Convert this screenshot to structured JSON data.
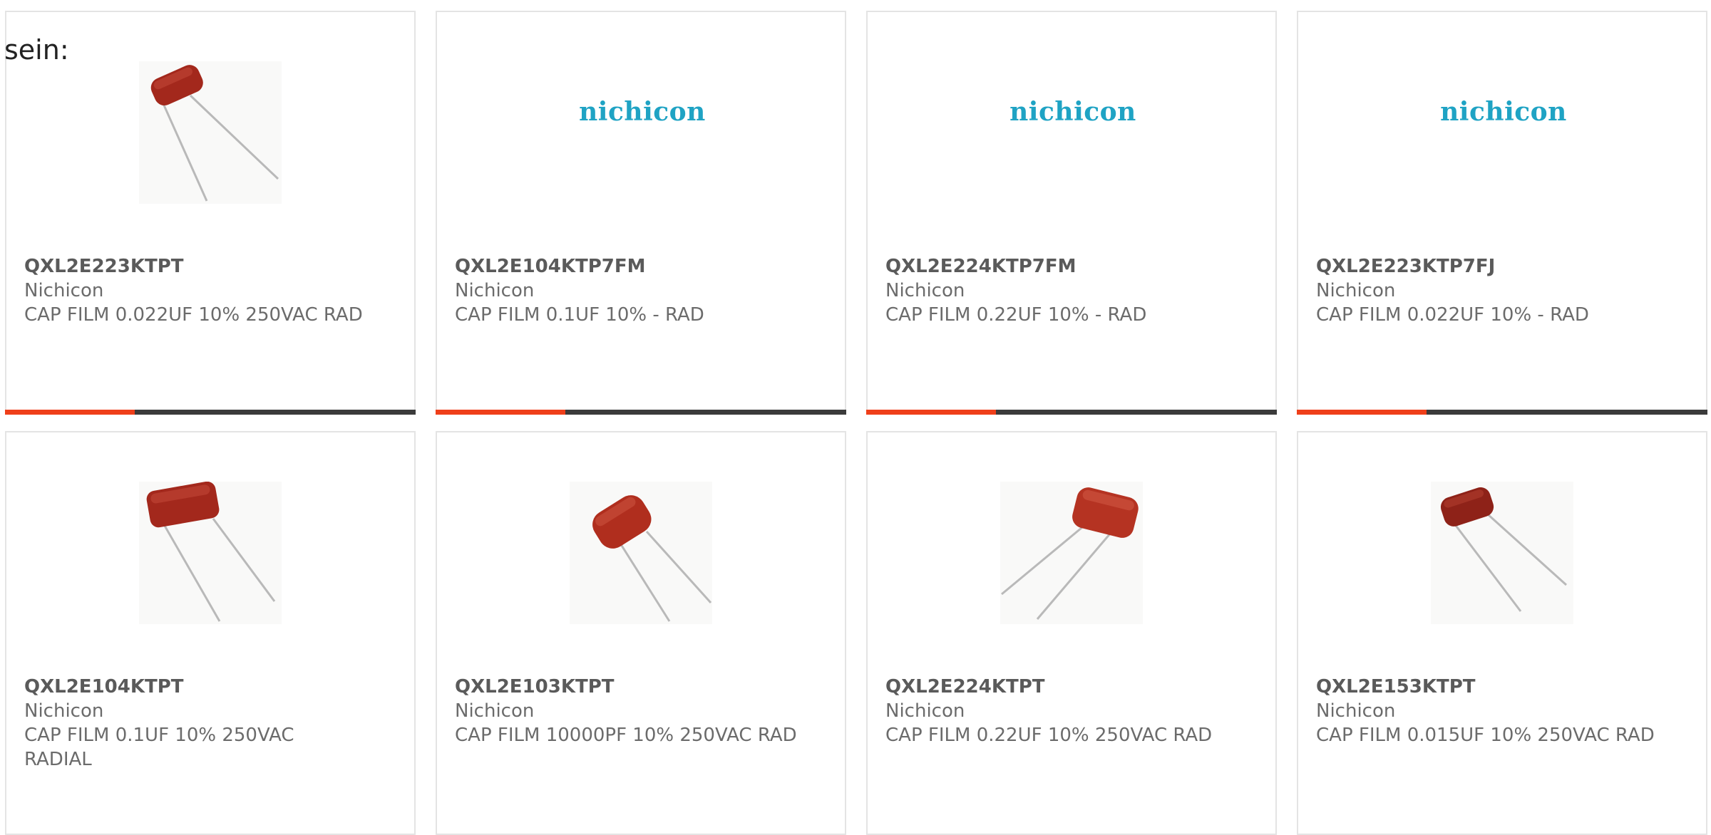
{
  "intro_text": "sein:",
  "colors": {
    "accent_bar": "#ef3f1a",
    "dark_bar": "#3b3b3b",
    "logo": "#1fa3c4",
    "capacitor_body": "#a3281c"
  },
  "products": [
    {
      "part_number": "QXL2E223KTPT",
      "manufacturer": "Nichicon",
      "description": "CAP FILM 0.022UF 10% 250VAC RAD",
      "image": "capacitor-photo"
    },
    {
      "part_number": "QXL2E104KTP7FM",
      "manufacturer": "Nichicon",
      "description": "CAP FILM 0.1UF 10% - RAD",
      "image": "nichicon-logo",
      "logo_text": "nichicon"
    },
    {
      "part_number": "QXL2E224KTP7FM",
      "manufacturer": "Nichicon",
      "description": "CAP FILM 0.22UF 10% - RAD",
      "image": "nichicon-logo",
      "logo_text": "nichicon"
    },
    {
      "part_number": "QXL2E223KTP7FJ",
      "manufacturer": "Nichicon",
      "description": "CAP FILM 0.022UF 10% - RAD",
      "image": "nichicon-logo",
      "logo_text": "nichicon"
    },
    {
      "part_number": "QXL2E104KTPT",
      "manufacturer": "Nichicon",
      "description": "CAP FILM 0.1UF 10% 250VAC RADIAL",
      "image": "capacitor-photo"
    },
    {
      "part_number": "QXL2E103KTPT",
      "manufacturer": "Nichicon",
      "description": "CAP FILM 10000PF 10% 250VAC RAD",
      "image": "capacitor-photo"
    },
    {
      "part_number": "QXL2E224KTPT",
      "manufacturer": "Nichicon",
      "description": "CAP FILM 0.22UF 10% 250VAC RAD",
      "image": "capacitor-photo"
    },
    {
      "part_number": "QXL2E153KTPT",
      "manufacturer": "Nichicon",
      "description": "CAP FILM 0.015UF 10% 250VAC RAD",
      "image": "capacitor-photo"
    }
  ]
}
